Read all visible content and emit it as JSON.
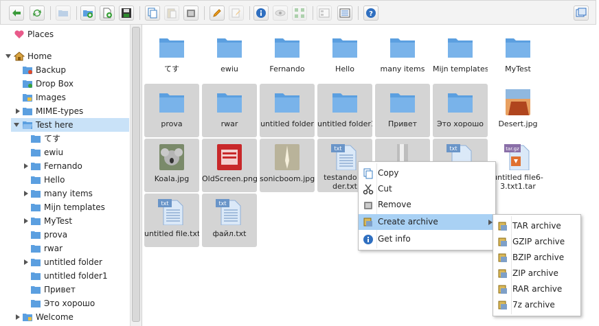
{
  "toolbar": {
    "buttons": [
      "back-icon",
      "reload-icon",
      "open-folder-icon",
      "new-folder-icon",
      "new-file-icon",
      "save-icon",
      "copy-icon",
      "paste-icon",
      "remove-icon",
      "rename-icon",
      "edit-icon",
      "info-icon",
      "view-icon",
      "grid-view-icon",
      "list-view-icon",
      "details-view-icon",
      "help-icon",
      "fullscreen-icon"
    ]
  },
  "sidebar": {
    "places": "Places",
    "home": "Home",
    "items": [
      "Backup",
      "Drop Box",
      "Images",
      "MIME-types",
      "Test here"
    ],
    "subitems": [
      "てす",
      "ewiu",
      "Fernando",
      "Hello",
      "many items",
      "Mijn templates",
      "MyTest",
      "prova",
      "rwar",
      "untitled folder",
      "untitled folder1",
      "Привет",
      "Это хорошо"
    ],
    "welcome": "Welcome"
  },
  "files": {
    "row1": [
      "てす",
      "ewiu",
      "Fernando",
      "Hello",
      "many items",
      "Mijn templates",
      "MyTest"
    ],
    "row2": [
      "prova",
      "rwar",
      "untitled folder",
      "untitled folder1",
      "Привет",
      "Это хорошо",
      "Desert.jpg"
    ],
    "row3": [
      "Koala.jpg",
      "OldScreen.png",
      "sonicboom.jpg",
      "testando el der.txt",
      "",
      "",
      "untitled file6-3.txt1.tar"
    ],
    "row4": [
      "untitled file.txt",
      "файл.txt"
    ],
    "badge_txt": "txt",
    "badge_targz": "tar.gz"
  },
  "context_menu": {
    "items": [
      "Copy",
      "Cut",
      "Remove",
      "Create archive",
      "Get info"
    ]
  },
  "archive_menu": {
    "items": [
      "TAR archive",
      "GZIP archive",
      "BZIP archive",
      "ZIP archive",
      "RAR archive",
      "7z archive"
    ]
  },
  "colors": {
    "folder": "#5b9fe0",
    "highlight": "#a9d1f4",
    "selection": "#d4d4d4"
  }
}
